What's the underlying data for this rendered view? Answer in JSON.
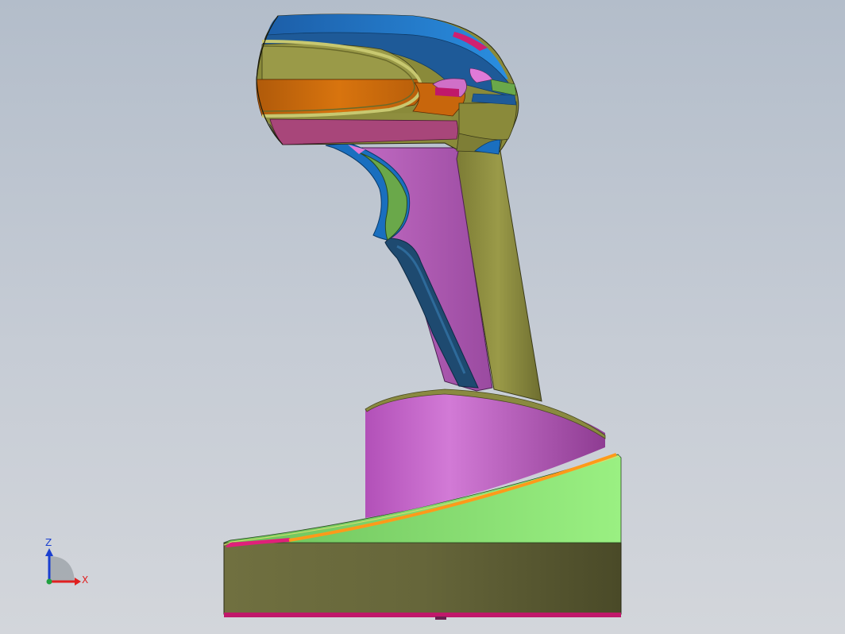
{
  "colors": {
    "background_top": "#b3bdca",
    "background_bottom": "#d3d6db",
    "head_blue": "#1a6fbf",
    "light_blue": "#2a8ee0",
    "olive": "#8a8a3a",
    "olive_dark": "#5e5e2c",
    "orange": "#c8660c",
    "magenta": "#a8467a",
    "pink": "#d070c8",
    "grip_purple": "#b058b0",
    "navy": "#1e4a70",
    "trigger_green": "#6aa84a",
    "base_green": "#88e070",
    "accent_orange": "#ff9a1a",
    "accent_pink": "#e0207a"
  },
  "triad": {
    "z_label": "Z",
    "x_label": "X",
    "z_color": "#1a3fd0",
    "x_color": "#e02020"
  }
}
